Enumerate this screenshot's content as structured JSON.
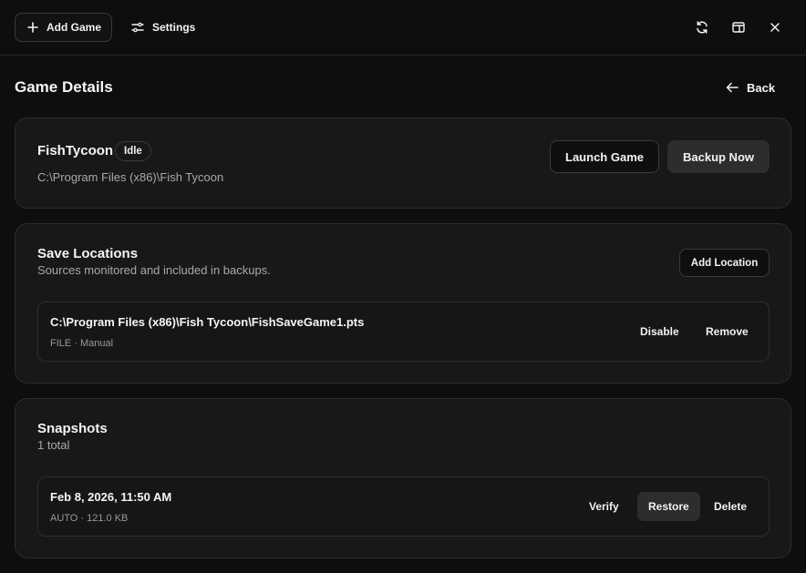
{
  "toolbar": {
    "add_game_label": "Add Game",
    "settings_label": "Settings",
    "icons": [
      "plus-icon",
      "sliders-icon",
      "refresh-icon",
      "window-icon",
      "close-icon"
    ]
  },
  "page": {
    "title": "Game Details",
    "back_label": "Back"
  },
  "game": {
    "name": "FishTycoon",
    "status": "Idle",
    "path": "C:\\Program Files (x86)\\Fish Tycoon",
    "launch_label": "Launch Game",
    "backup_label": "Backup Now"
  },
  "save_locations": {
    "title": "Save Locations",
    "subtitle": "Sources monitored and included in backups.",
    "add_label": "Add Location",
    "items": [
      {
        "path": "C:\\Program Files (x86)\\Fish Tycoon\\FishSaveGame1.pts",
        "meta": "FILE · Manual",
        "disable_label": "Disable",
        "remove_label": "Remove"
      }
    ]
  },
  "snapshots": {
    "title": "Snapshots",
    "count": "1 total",
    "items": [
      {
        "date": "Feb 8, 2026, 11:50 AM",
        "meta": "AUTO · 121.0 KB",
        "verify_label": "Verify",
        "restore_label": "Restore",
        "delete_label": "Delete"
      }
    ]
  }
}
